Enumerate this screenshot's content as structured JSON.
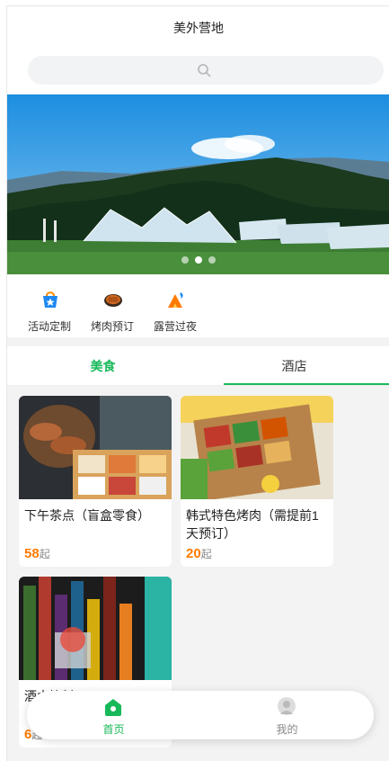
{
  "header": {
    "title": "美外营地"
  },
  "search": {
    "placeholder": ""
  },
  "banner": {
    "slides": 3,
    "active_index": 1
  },
  "quick_links": [
    {
      "label": "活动定制",
      "icon": "gift-bag-icon"
    },
    {
      "label": "烤肉预订",
      "icon": "bbq-grill-icon"
    },
    {
      "label": "露营过夜",
      "icon": "campfire-tent-icon"
    }
  ],
  "tabs": [
    {
      "label": "美食",
      "active": true
    },
    {
      "label": "酒店",
      "active": false
    }
  ],
  "products": [
    {
      "name": "下午茶点（盲盒零食）",
      "price": "58",
      "suffix": "起",
      "image": "snack-box-photo"
    },
    {
      "name": "韩式特色烤肉（需提前1天预订）",
      "price": "20",
      "suffix": "起",
      "image": "korean-bbq-photo"
    },
    {
      "name": "酒水饮料",
      "price": "6",
      "suffix": "起",
      "image": "drinks-bottles-photo"
    }
  ],
  "bottom_nav": [
    {
      "label": "首页",
      "icon": "home-icon",
      "active": true
    },
    {
      "label": "我的",
      "icon": "user-icon",
      "active": false
    }
  ],
  "colors": {
    "accent": "#19b95a",
    "price": "#ff7a00"
  }
}
